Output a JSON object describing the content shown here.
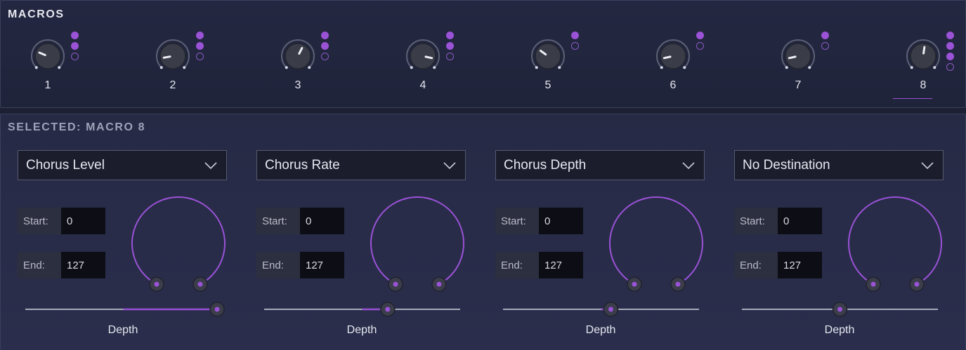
{
  "macros": {
    "title": "MACROS",
    "selected_index": 8,
    "knobs": [
      {
        "label": "1",
        "value": 0.25,
        "dots": [
          1,
          1,
          0
        ]
      },
      {
        "label": "2",
        "value": 0.13,
        "dots": [
          1,
          1,
          0
        ]
      },
      {
        "label": "3",
        "value": 0.6,
        "dots": [
          1,
          1,
          0
        ]
      },
      {
        "label": "4",
        "value": 0.88,
        "dots": [
          1,
          1,
          0
        ]
      },
      {
        "label": "5",
        "value": 0.3,
        "dots": [
          1,
          0
        ]
      },
      {
        "label": "6",
        "value": 0.12,
        "dots": [
          1,
          0
        ]
      },
      {
        "label": "7",
        "value": 0.12,
        "dots": [
          1,
          0
        ]
      },
      {
        "label": "8",
        "value": 0.53,
        "dots": [
          1,
          1,
          1,
          0
        ]
      }
    ]
  },
  "selected": {
    "title": "SELECTED: MACRO 8",
    "slots": [
      {
        "destination": "Chorus Level",
        "start_label": "Start:",
        "start": "0",
        "end_label": "End:",
        "end": "127",
        "depth_label": "Depth",
        "depth": 1.0
      },
      {
        "destination": "Chorus Rate",
        "start_label": "Start:",
        "start": "0",
        "end_label": "End:",
        "end": "127",
        "depth_label": "Depth",
        "depth": 0.63
      },
      {
        "destination": "Chorus Depth",
        "start_label": "Start:",
        "start": "0",
        "end_label": "End:",
        "end": "127",
        "depth_label": "Depth",
        "depth": 0.55
      },
      {
        "destination": "No Destination",
        "start_label": "Start:",
        "start": "0",
        "end_label": "End:",
        "end": "127",
        "depth_label": "Depth",
        "depth": 0.5
      }
    ]
  },
  "colors": {
    "accent": "#9a52d6",
    "track": "#a9abb8",
    "knob": "#3b3d49"
  }
}
